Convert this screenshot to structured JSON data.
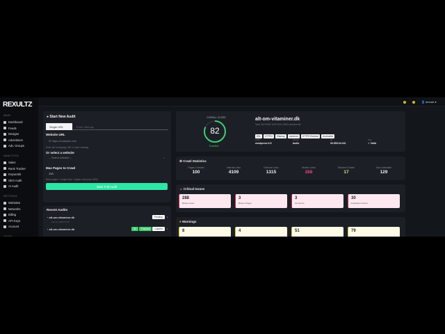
{
  "brand": "REXULTZ",
  "sidebar": {
    "sections": [
      {
        "title": "MAIN",
        "items": [
          "Dashboard",
          "Feeds",
          "Designs",
          "Advertisers",
          "Adv. Groups"
        ]
      },
      {
        "title": "ANALYTICS",
        "items": [
          "Sales",
          "Rank Tracker",
          "Keywords",
          "SEO Audit",
          "AI Audit"
        ]
      },
      {
        "title": "SETTINGS",
        "items": [
          "Websites",
          "Networks",
          "Billing",
          "API Keys",
          "Account"
        ]
      },
      {
        "title": "ADMIN",
        "items": []
      }
    ]
  },
  "topbar": {
    "user": "lennart"
  },
  "audit_form": {
    "title": "Start New Audit",
    "tabs": [
      "Single URL",
      "From Sitemap"
    ],
    "url_label": "Website URL",
    "url_placeholder": "https://example.com",
    "url_help": "Enter the homepage URL to start crawling",
    "select_label": "Or select a website",
    "select_value": "-- Select website --",
    "max_label": "Max Pages to Crawl",
    "max_value": "100",
    "max_help": "More pages = longer time + higher cost (max 1000)",
    "submit": "Start Full Audit"
  },
  "recent": {
    "title": "Recent Audits",
    "items": [
      {
        "domain": "alt-om-vitaminer.dk",
        "date": "Feb 10, 2025 03:15",
        "badges": [
          "Pending"
        ]
      },
      {
        "domain": "alt-om-vitaminer.dk",
        "date": "",
        "badges": [
          "82",
          "Finished",
          "Cached"
        ]
      }
    ]
  },
  "overview": {
    "score_label": "OVERALL SCORE",
    "score": "82",
    "score_rating": "Excellent",
    "score_pct": 82,
    "domain": "alt-om-vitaminer.dk",
    "subtitle": "Task 01070052-2025 0210-0800-vitaminerdk",
    "tags": [
      "SSL",
      "HTTP/2",
      "Sitemap",
      "robots.txt",
      "HTTPS Redirect",
      "Accessible"
    ],
    "meta": [
      {
        "label": "CMS",
        "value": "wordpress 6.9"
      },
      {
        "label": "Server",
        "value": "bodis"
      },
      {
        "label": "IP",
        "value": "93.555.34.242"
      },
      {
        "label": "SSL",
        "value": "✓ Valid"
      }
    ]
  },
  "crawl": {
    "title": "Crawl Statistics",
    "stats": [
      {
        "label": "Pages Crawled",
        "value": "100"
      },
      {
        "label": "Internal Links",
        "value": "4109"
      },
      {
        "label": "External Links",
        "value": "1315"
      },
      {
        "label": "Broken Links",
        "value": "288",
        "color": "#e0457b"
      },
      {
        "label": "Redirect Chains",
        "value": "17",
        "color": "#e8d98a"
      },
      {
        "label": "Non-Indexable",
        "value": "129"
      }
    ]
  },
  "critical": {
    "title": "Critical Issues",
    "items": [
      {
        "value": "288",
        "label": "Broken Links"
      },
      {
        "value": "3",
        "label": "Broken Pages"
      },
      {
        "value": "3",
        "label": "4xx Errors"
      },
      {
        "value": "30",
        "label": "Duplicate Content"
      }
    ]
  },
  "warnings": {
    "title": "Warnings",
    "items": [
      {
        "value": "8"
      },
      {
        "value": "4"
      },
      {
        "value": "51"
      },
      {
        "value": "79"
      }
    ]
  }
}
